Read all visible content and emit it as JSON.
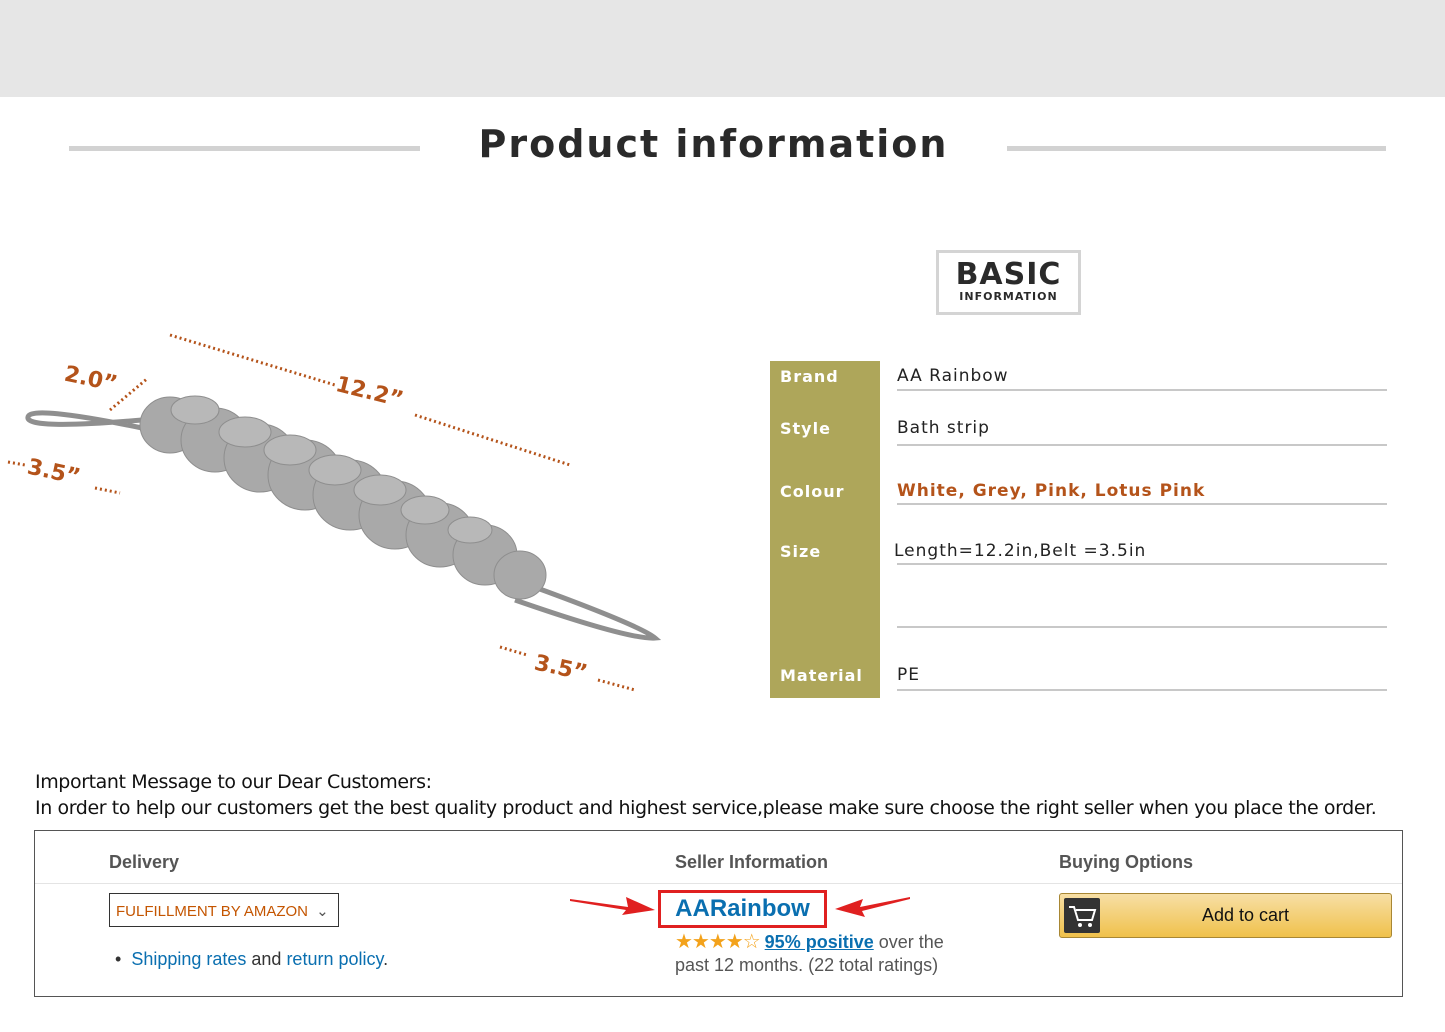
{
  "header": {
    "title": "Product information"
  },
  "basic_info": {
    "badge_big": "BASIC",
    "badge_small": "INFORMATION",
    "rows": [
      {
        "label": "Brand",
        "value": "AA Rainbow"
      },
      {
        "label": "Style",
        "value": "Bath strip"
      },
      {
        "label": "Colour",
        "value": "White, Grey, Pink, Lotus Pink"
      },
      {
        "label": "Size",
        "value": "Length=12.2in,Belt =3.5in"
      },
      {
        "label": "Material",
        "value": "PE"
      }
    ]
  },
  "product_image": {
    "dim_width": "2.0”",
    "dim_length": "12.2”",
    "dim_belt_left": "3.5”",
    "dim_belt_right": "3.5”",
    "accent_color": "#b4531a",
    "body_color": "#a9a9a9"
  },
  "message": {
    "line1": "Important Message to our Dear Customers:",
    "line2": "In order to help our customers get the best quality product and highest service,please make sure choose the right seller when you place the order."
  },
  "offer": {
    "delivery_header": "Delivery",
    "seller_header": "Seller Information",
    "buying_header": "Buying Options",
    "fulfillment_label": "FULFILLMENT BY AMAZON",
    "shipping_link": "Shipping rates",
    "and_text": " and ",
    "return_link": "return policy",
    "period": ".",
    "seller_name": "AARainbow",
    "stars": "★★★★☆",
    "positive_pct": "95% positive",
    "over_the": " over the",
    "period_text": "past 12 months. (22 total ratings)",
    "add_to_cart": "Add to cart",
    "highlight_color": "#e02020"
  }
}
